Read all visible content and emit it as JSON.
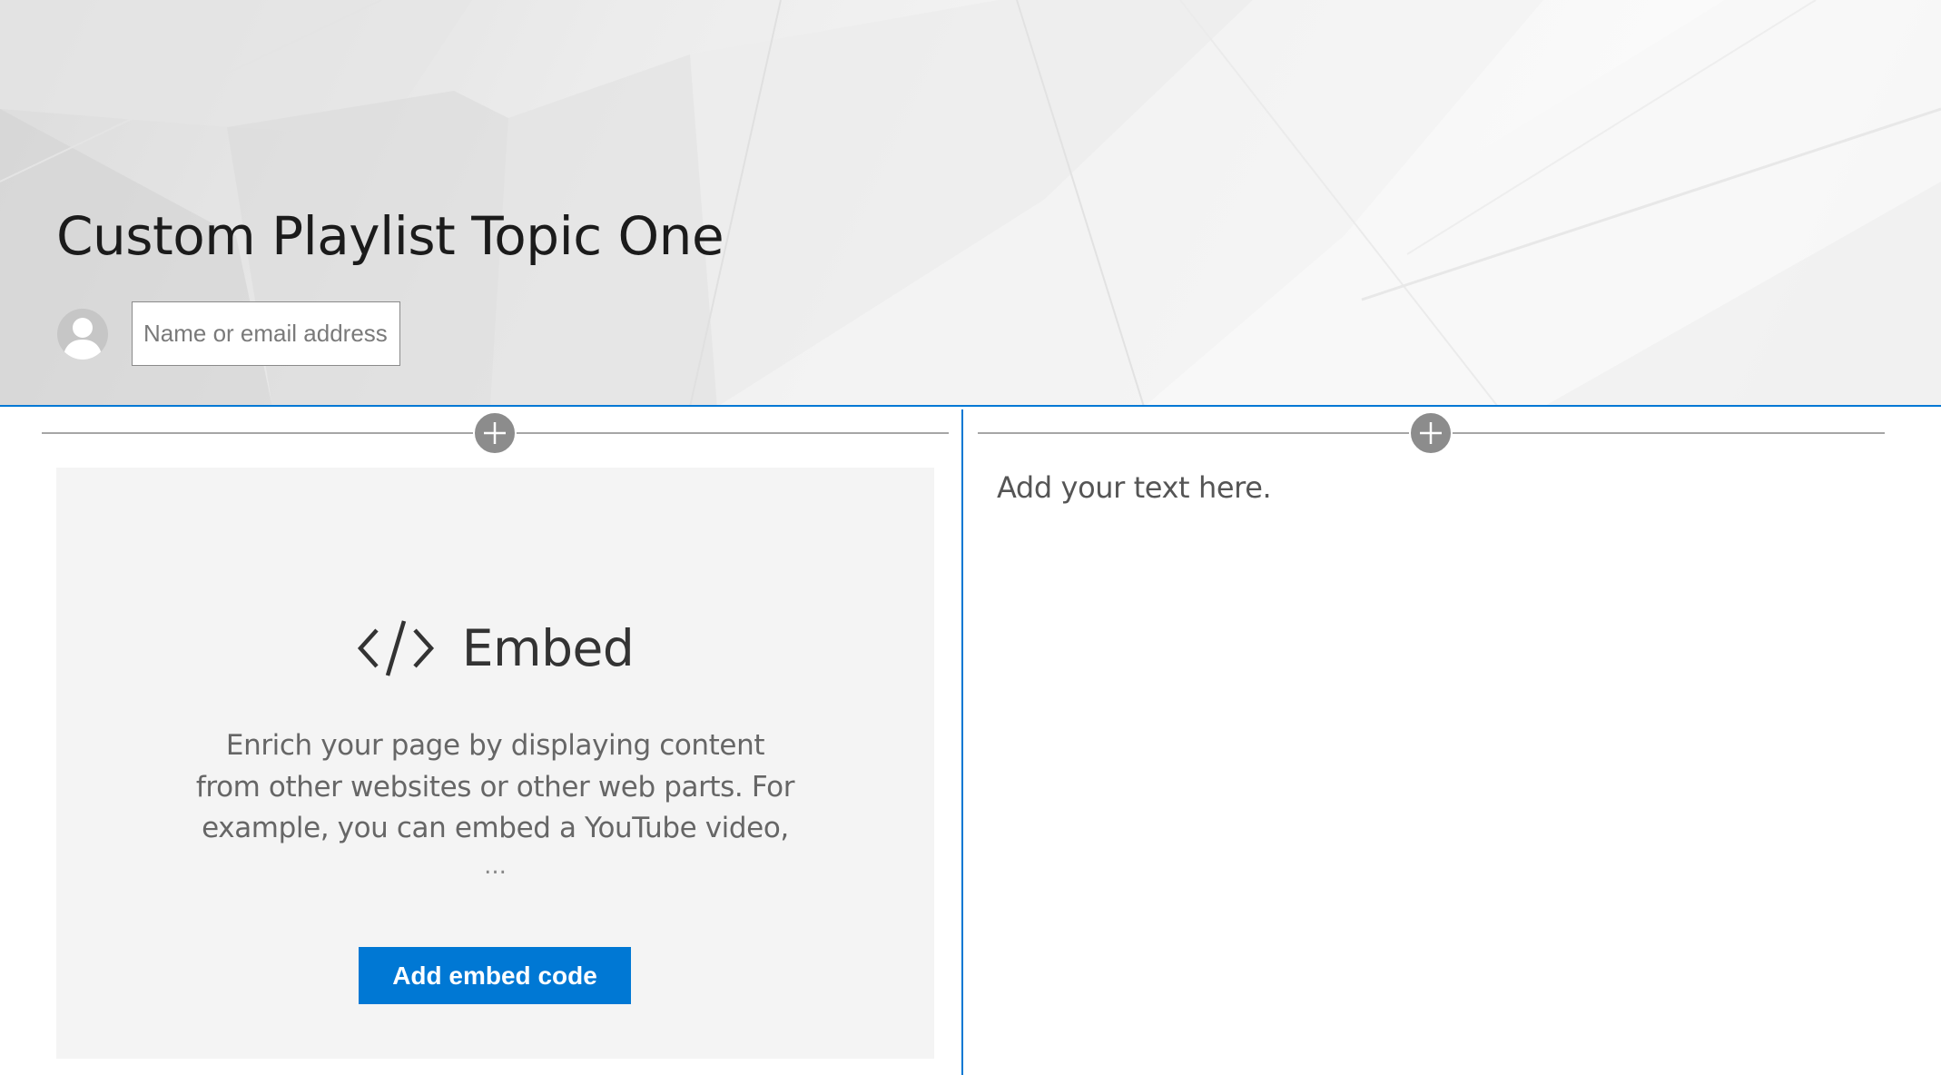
{
  "page": {
    "title": "Custom Playlist Topic One"
  },
  "author": {
    "avatar_icon": "person-icon",
    "input_placeholder": "Name or email address"
  },
  "sections": {
    "add_icon": "plus-icon"
  },
  "embed": {
    "icon": "code-icon",
    "title": "Embed",
    "description": "Enrich your page by displaying content from other websites or other web parts. For example, you can embed a YouTube video,",
    "ellipsis": "...",
    "button_label": "Add embed code"
  },
  "text_webpart": {
    "placeholder": "Add your text here."
  },
  "colors": {
    "accent": "#0078d4",
    "placeholder_card": "#f4f4f4"
  }
}
